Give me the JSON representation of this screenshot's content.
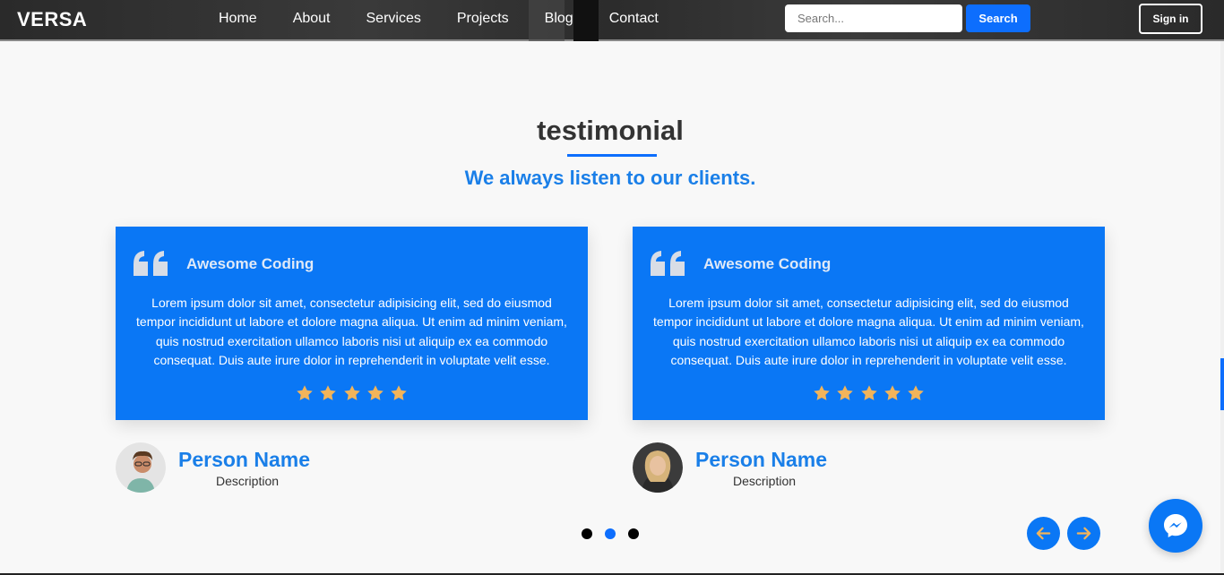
{
  "navbar": {
    "brand": "VERSA",
    "links": [
      "Home",
      "About",
      "Services",
      "Projects",
      "Blog",
      "Contact"
    ],
    "search_placeholder": "Search...",
    "search_label": "Search",
    "signin_label": "Sign in"
  },
  "section": {
    "title": "testimonial",
    "subtitle": "We always listen to our clients."
  },
  "testimonials": [
    {
      "title": "Awesome Coding",
      "text": "Lorem ipsum dolor sit amet, consectetur adipisicing elit, sed do eiusmod tempor incididunt ut labore et dolore magna aliqua. Ut enim ad minim veniam, quis nostrud exercitation ullamco laboris nisi ut aliquip ex ea commodo consequat. Duis aute irure dolor in reprehenderit in voluptate velit esse.",
      "rating": 5,
      "person_name": "Person Name",
      "person_desc": "Description"
    },
    {
      "title": "Awesome Coding",
      "text": "Lorem ipsum dolor sit amet, consectetur adipisicing elit, sed do eiusmod tempor incididunt ut labore et dolore magna aliqua. Ut enim ad minim veniam, quis nostrud exercitation ullamco laboris nisi ut aliquip ex ea commodo consequat. Duis aute irure dolor in reprehenderit in voluptate velit esse.",
      "rating": 5,
      "person_name": "Person Name",
      "person_desc": "Description"
    }
  ],
  "carousel": {
    "dots": 3,
    "active_dot": 1
  },
  "colors": {
    "accent": "#0d6efd",
    "card_bg": "#0a77f5",
    "star": "#f2b45a",
    "heading_blue": "#1a7fe8"
  },
  "icons": {
    "quote": "quote-icon",
    "star": "star-icon",
    "prev": "arrow-left-icon",
    "next": "arrow-right-icon",
    "messenger": "messenger-icon"
  }
}
